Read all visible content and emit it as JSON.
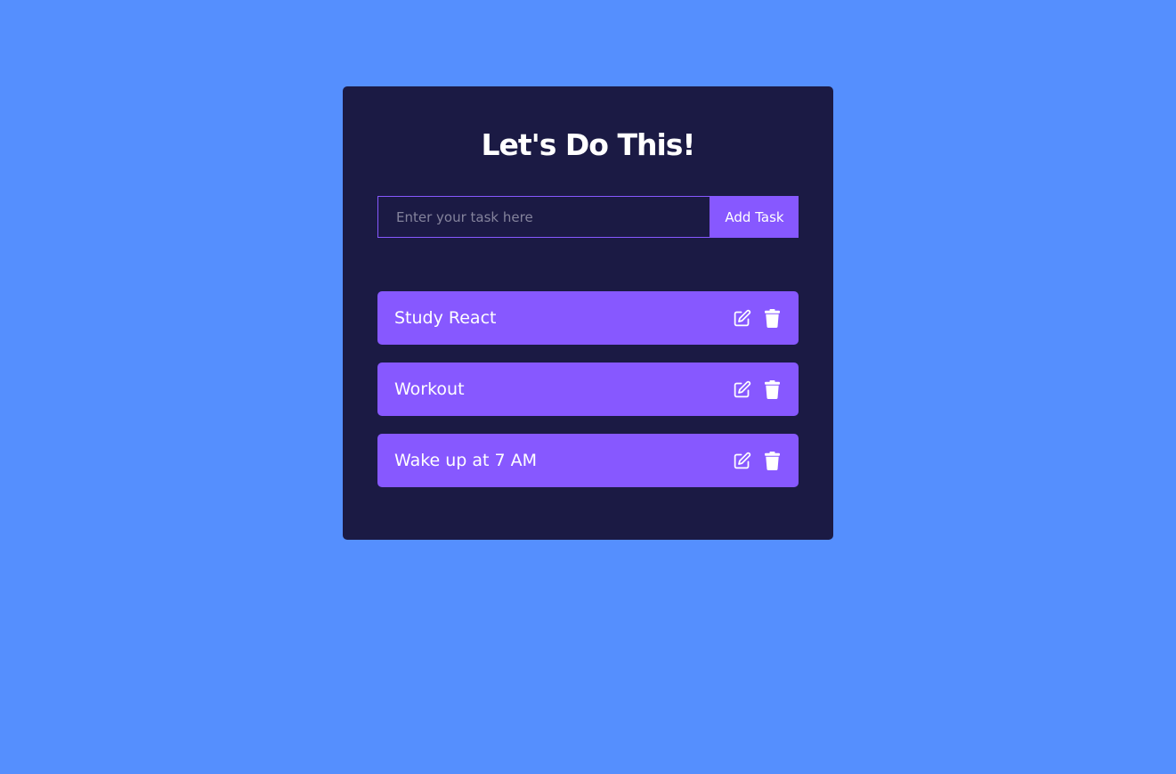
{
  "app": {
    "title": "Let's Do This!"
  },
  "form": {
    "input_value": "",
    "input_placeholder": "Enter your task here",
    "add_button_label": "Add Task"
  },
  "tasks": [
    {
      "label": "Study React",
      "edit_icon": "edit-icon",
      "delete_icon": "trash-icon"
    },
    {
      "label": "Workout",
      "edit_icon": "edit-icon",
      "delete_icon": "trash-icon"
    },
    {
      "label": "Wake up at 7 AM",
      "edit_icon": "edit-icon",
      "delete_icon": "trash-icon"
    }
  ],
  "colors": {
    "background": "#558ffe",
    "card": "#1b1a44",
    "accent": "#8758ff",
    "text": "#ffffff",
    "placeholder": "#84839c"
  }
}
